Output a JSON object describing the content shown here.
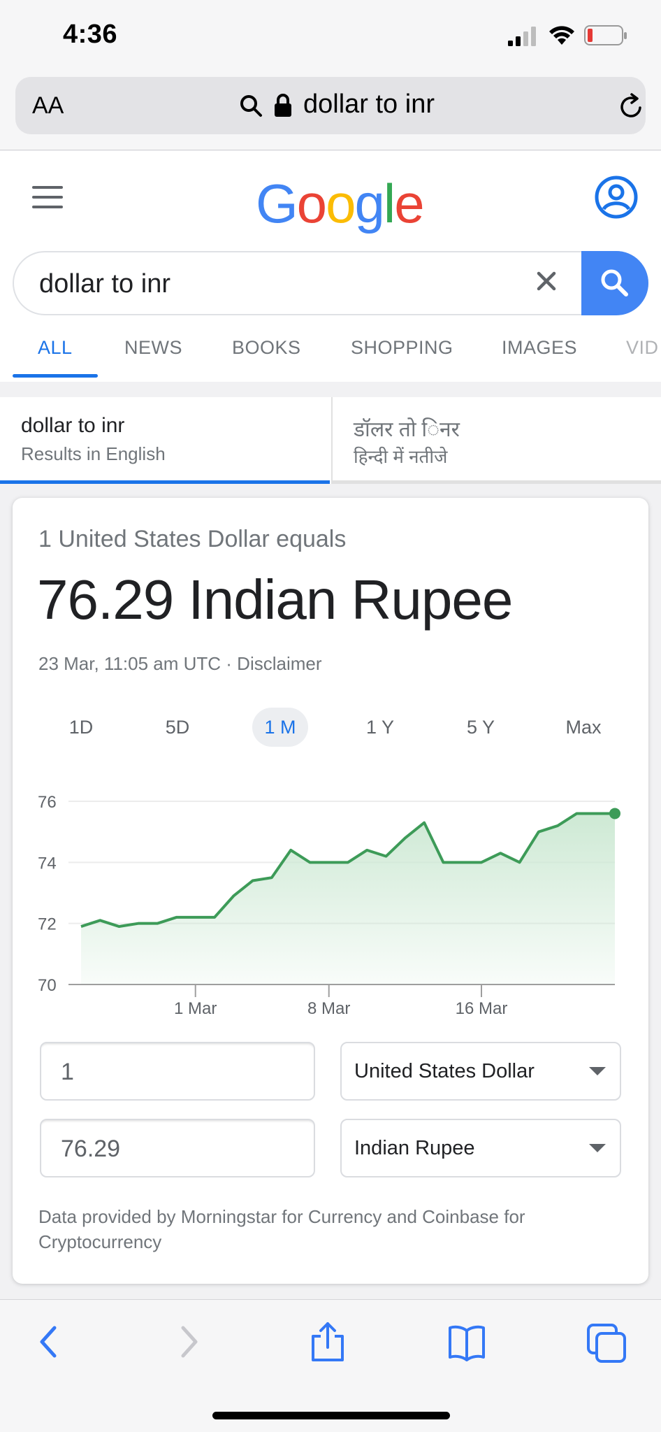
{
  "status_bar": {
    "time": "4:36"
  },
  "address_bar": {
    "text_size_label": "AA",
    "url": "dollar to inr"
  },
  "google": {
    "logo": [
      "G",
      "o",
      "o",
      "g",
      "l",
      "e"
    ],
    "search_query": "dollar to inr",
    "tabs": [
      "ALL",
      "NEWS",
      "BOOKS",
      "SHOPPING",
      "IMAGES",
      "VID"
    ],
    "active_tab": "ALL"
  },
  "language_tabs": [
    {
      "title": "dollar to inr",
      "subtitle": "Results in English"
    },
    {
      "title": "डॉलर तो िनर",
      "subtitle": "हिन्दी में नतीजे"
    }
  ],
  "converter": {
    "equals_label": "1 United States Dollar equals",
    "result": "76.29 Indian Rupee",
    "updated": "23 Mar, 11:05 am UTC · Disclaimer",
    "ranges": [
      "1D",
      "5D",
      "1 M",
      "1 Y",
      "5 Y",
      "Max"
    ],
    "active_range": "1 M",
    "from_amount": "1",
    "from_currency": "United States Dollar",
    "to_amount": "76.29",
    "to_currency": "Indian Rupee",
    "source_note": "Data provided by Morningstar for Currency and Coinbase for Cryptocurrency"
  },
  "chart_data": {
    "type": "area",
    "x_ticks": [
      "1 Mar",
      "8 Mar",
      "16 Mar"
    ],
    "y_ticks": [
      70,
      72,
      74,
      76
    ],
    "ylim": [
      70,
      76
    ],
    "values": [
      71.9,
      72.1,
      71.9,
      72.0,
      72.0,
      72.2,
      72.2,
      72.2,
      72.9,
      73.4,
      73.5,
      74.4,
      74.0,
      74.0,
      74.0,
      74.4,
      74.2,
      74.8,
      75.3,
      74.0,
      74.0,
      74.0,
      74.3,
      74.0,
      75.0,
      75.2,
      75.6,
      75.6,
      75.6
    ],
    "line_color": "#3d9b58",
    "fill_color": "#cbe8d2",
    "grid": true
  }
}
